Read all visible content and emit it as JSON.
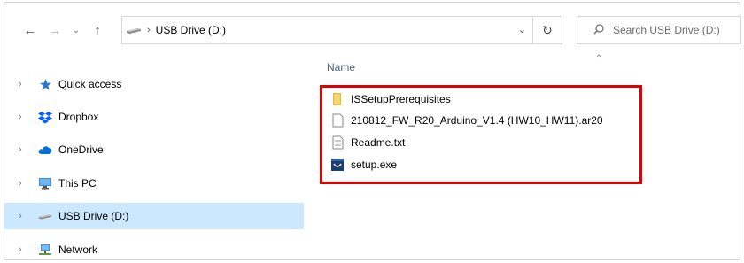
{
  "address_bar": {
    "back_icon": "arrow-left-icon",
    "forward_icon": "arrow-right-icon",
    "recent_icon": "chevron-down-icon",
    "up_icon": "arrow-up-icon",
    "drive_icon": "usb-drive-icon",
    "path": "USB Drive (D:)",
    "refresh_icon": "refresh-icon"
  },
  "search": {
    "placeholder": "Search USB Drive (D:)"
  },
  "nav_pane": {
    "items": [
      {
        "label": "Quick access",
        "icon": "star-icon"
      },
      {
        "label": "Dropbox",
        "icon": "dropbox-icon"
      },
      {
        "label": "OneDrive",
        "icon": "cloud-icon"
      },
      {
        "label": "This PC",
        "icon": "monitor-icon"
      },
      {
        "label": "USB Drive (D:)",
        "icon": "usb-drive-icon",
        "selected": true
      },
      {
        "label": "Network",
        "icon": "network-icon"
      }
    ]
  },
  "content": {
    "column_header": "Name",
    "files": [
      {
        "name": "ISSetupPrerequisites",
        "icon": "folder-icon"
      },
      {
        "name": "210812_FW_R20_Arduino_V1.4 (HW10_HW11).ar20",
        "icon": "file-icon"
      },
      {
        "name": "Readme.txt",
        "icon": "text-file-icon"
      },
      {
        "name": "setup.exe",
        "icon": "installer-icon"
      }
    ]
  },
  "colors": {
    "selection": "#cce8ff",
    "highlight_border": "#e00000",
    "header_text": "#4c607a"
  }
}
